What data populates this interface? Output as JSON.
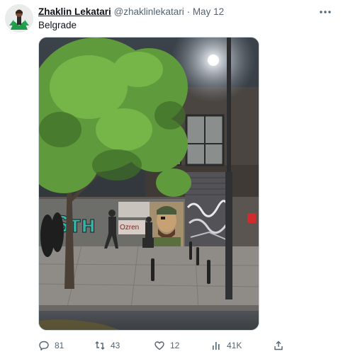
{
  "tweet": {
    "author_name": "Zhaklin Lekatari",
    "handle": "@zhaklinlekatari",
    "separator": " · ",
    "date": "May 12",
    "text": "Belgrade"
  },
  "media": {
    "graffiti_texts": [
      "Ѕтн",
      "Ozren"
    ]
  },
  "actions": {
    "replies": "81",
    "retweets": "43",
    "likes": "12",
    "views": "41K"
  },
  "icons": {
    "more": "more-horizontal-icon",
    "reply": "reply-icon",
    "retweet": "retweet-icon",
    "like": "heart-icon",
    "views": "views-icon",
    "share": "share-icon"
  },
  "colors": {
    "icon_gray": "#536471",
    "border": "#cfd9de",
    "text": "#0f1419"
  }
}
